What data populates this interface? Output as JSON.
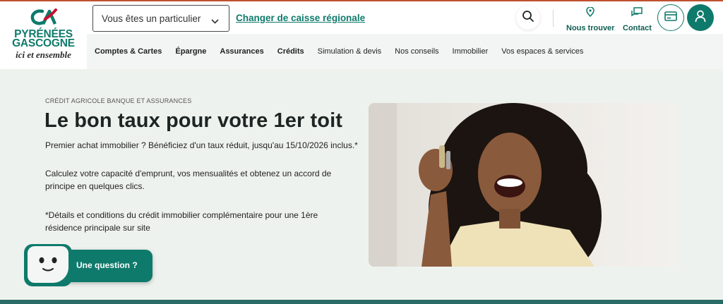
{
  "brand": {
    "name_line1": "PYRÉNÉES",
    "name_line2": "GASCOGNE",
    "tagline": "ici et ensemble",
    "color": "#0e7a6b",
    "accent": "#c8102e"
  },
  "header": {
    "select_value": "Vous êtes un particulier",
    "change_region_link": "Changer de caisse régionale",
    "search_icon": "search-icon",
    "find_us_label": "Nous trouver",
    "contact_label": "Contact",
    "card_icon": "credit-card-icon",
    "account_icon": "user-icon"
  },
  "nav": {
    "items": [
      {
        "label": "Comptes & Cartes"
      },
      {
        "label": "Épargne"
      },
      {
        "label": "Assurances"
      },
      {
        "label": "Crédits"
      },
      {
        "label": "Simulation & devis"
      },
      {
        "label": "Nos conseils"
      },
      {
        "label": "Immobilier"
      },
      {
        "label": "Vos espaces & services"
      }
    ]
  },
  "hero": {
    "kicker": "CRÉDIT AGRICOLE BANQUE ET ASSURANCES",
    "title": "Le bon taux pour votre 1er toit",
    "p1": "Premier achat immobilier ? Bénéficiez d'un taux réduit, jusqu'au 15/10/2026 inclus.*",
    "p2": "Calculez votre capacité d'emprunt, vos mensualités et obtenez un accord de principe en quelques clics.",
    "p3": "*Détails et conditions du crédit immobilier complémentaire pour une 1ère résidence principale sur site"
  },
  "chat": {
    "label": "Une question ?"
  }
}
